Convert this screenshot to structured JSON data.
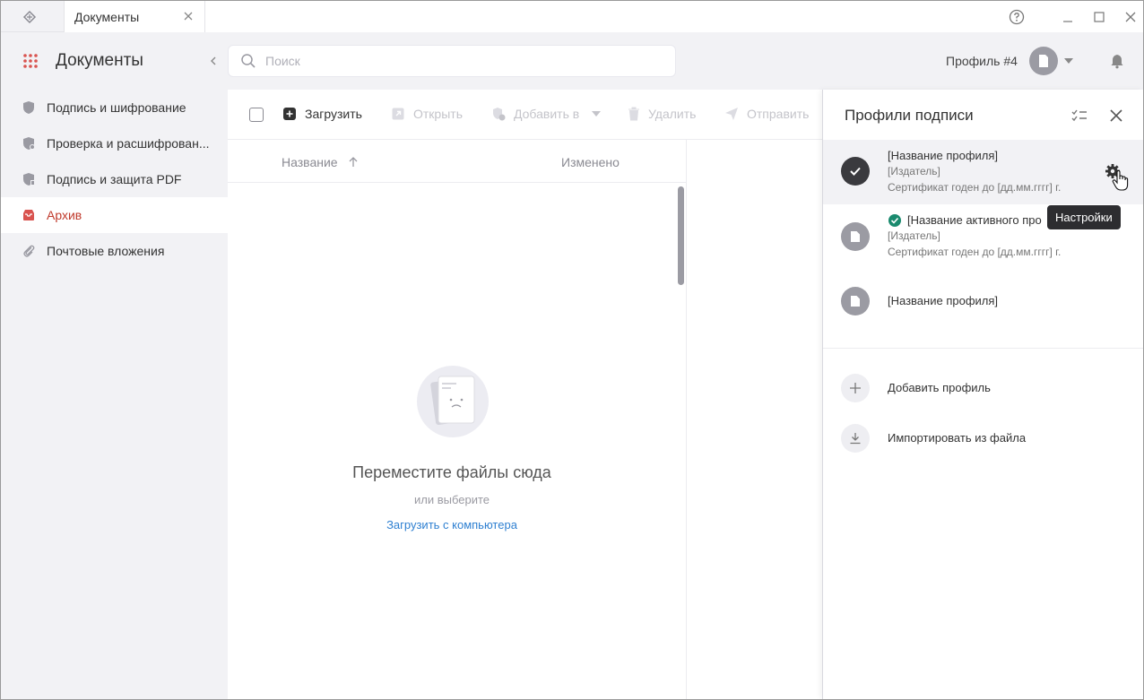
{
  "tab": {
    "label": "Документы"
  },
  "header": {
    "app_title": "Документы",
    "search_placeholder": "Поиск",
    "profile_label": "Профиль #4"
  },
  "sidebar": {
    "items": [
      {
        "label": "Подпись и шифрование",
        "icon": "shield-lock-icon",
        "active": false
      },
      {
        "label": "Проверка и расшифрован...",
        "icon": "shield-check-icon",
        "active": false
      },
      {
        "label": "Подпись и защита PDF",
        "icon": "shield-pdf-icon",
        "active": false
      },
      {
        "label": "Архив",
        "icon": "archive-inbox-icon",
        "active": true
      },
      {
        "label": "Почтовые вложения",
        "icon": "paperclip-icon",
        "active": false
      }
    ]
  },
  "toolbar": {
    "upload": "Загрузить",
    "open": "Открыть",
    "add_to": "Добавить в",
    "delete": "Удалить",
    "send": "Отправить"
  },
  "table": {
    "col_name": "Название",
    "col_changed": "Изменено"
  },
  "empty": {
    "title": "Переместите файлы сюда",
    "subtitle": "или выберите",
    "link": "Загрузить с компьютера"
  },
  "profiles_panel": {
    "title": "Профили подписи",
    "profiles": [
      {
        "name": "[Название профиля]",
        "issuer": "[Издатель]",
        "validity": "Сертификат годен до [дд.мм.гггг] г."
      },
      {
        "name": "[Название активного про",
        "issuer": "[Издатель]",
        "validity": "Сертификат годен до [дд.мм.гггг] г."
      },
      {
        "name": "[Название профиля]"
      }
    ],
    "add_profile": "Добавить профиль",
    "import_file": "Импортировать из файла",
    "tooltip": "Настройки"
  },
  "colors": {
    "accent_red": "#c0392b",
    "link_blue": "#2f80d1",
    "active_green": "#1a8a6e"
  }
}
